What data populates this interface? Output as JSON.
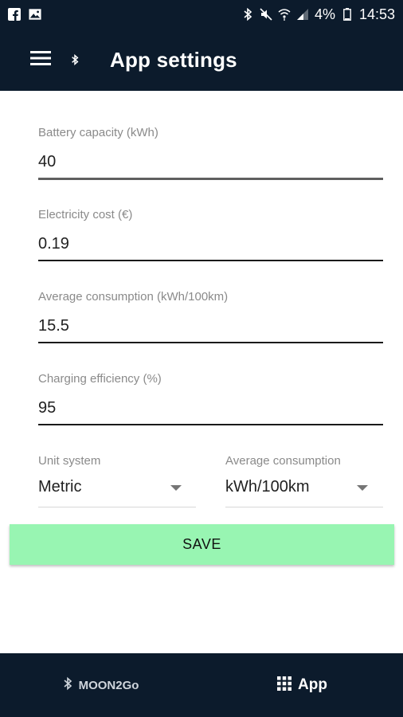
{
  "status_bar": {
    "battery_percent": "4%",
    "time": "14:53",
    "left_icons": [
      "facebook-icon",
      "image-icon"
    ],
    "right_icons": [
      "bluetooth-icon",
      "mute-icon",
      "wifi-icon",
      "signal-icon",
      "battery-icon"
    ]
  },
  "app_bar": {
    "title": "App settings",
    "menu_icon": "menu-icon",
    "bluetooth_icon": "bluetooth-icon",
    "background": "#0c1b2c"
  },
  "fields": [
    {
      "label": "Battery capacity (kWh)",
      "value": "40"
    },
    {
      "label": "Electricity cost (€)",
      "value": "0.19"
    },
    {
      "label": "Average consumption (kWh/100km)",
      "value": "15.5"
    },
    {
      "label": "Charging efficiency (%)",
      "value": "95"
    }
  ],
  "selects": [
    {
      "label": "Unit system",
      "value": "Metric"
    },
    {
      "label": "Average consumption",
      "value": "kWh/100km"
    }
  ],
  "save_button": {
    "label": "SAVE",
    "color": "#98f5b2"
  },
  "bottom_nav": {
    "items": [
      {
        "label": "MOON2Go",
        "icon": "bluetooth-icon"
      },
      {
        "label": "App",
        "icon": "grid-icon"
      }
    ]
  }
}
